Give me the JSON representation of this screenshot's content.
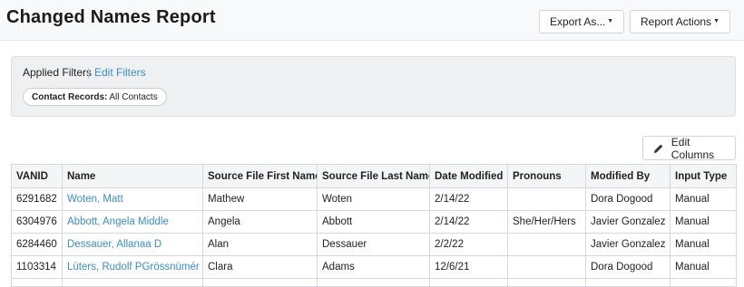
{
  "header": {
    "title": "Changed Names Report",
    "export_label": "Export As...",
    "actions_label": "Report Actions",
    "caret": "▼"
  },
  "filters": {
    "title": "Applied Filters",
    "edit_label": "Edit Filters",
    "chip_key": "Contact Records:",
    "chip_value": "All Contacts"
  },
  "edit_columns_label": "Edit Columns",
  "table": {
    "columns": [
      "VANID",
      "Name",
      "Source File First Name",
      "Source File Last Name",
      "Date Modified",
      "Pronouns",
      "Modified By",
      "Input Type"
    ],
    "rows": [
      {
        "vanid": "6291682",
        "name": "Woten, Matt",
        "first": "Mathew",
        "last": "Woten",
        "date": "2/14/22",
        "pronouns": "",
        "modified_by": "Dora Dogood",
        "input_type": "Manual"
      },
      {
        "vanid": "6304976",
        "name": "Abbott, Angela Middle",
        "first": "Angela",
        "last": "Abbott",
        "date": "2/14/22",
        "pronouns": "She/Her/Hers",
        "modified_by": "Javier Gonzalez",
        "input_type": "Manual"
      },
      {
        "vanid": "6284460",
        "name": "Dessauer, Allanaa D",
        "first": "Alan",
        "last": "Dessauer",
        "date": "2/2/22",
        "pronouns": "",
        "modified_by": "Javier Gonzalez",
        "input_type": "Manual"
      },
      {
        "vanid": "1103314",
        "name": "Lüters, Rudolf PGrössnümér",
        "first": "Clara",
        "last": "Adams",
        "date": "12/6/21",
        "pronouns": "",
        "modified_by": "Dora Dogood",
        "input_type": "Manual"
      }
    ]
  }
}
